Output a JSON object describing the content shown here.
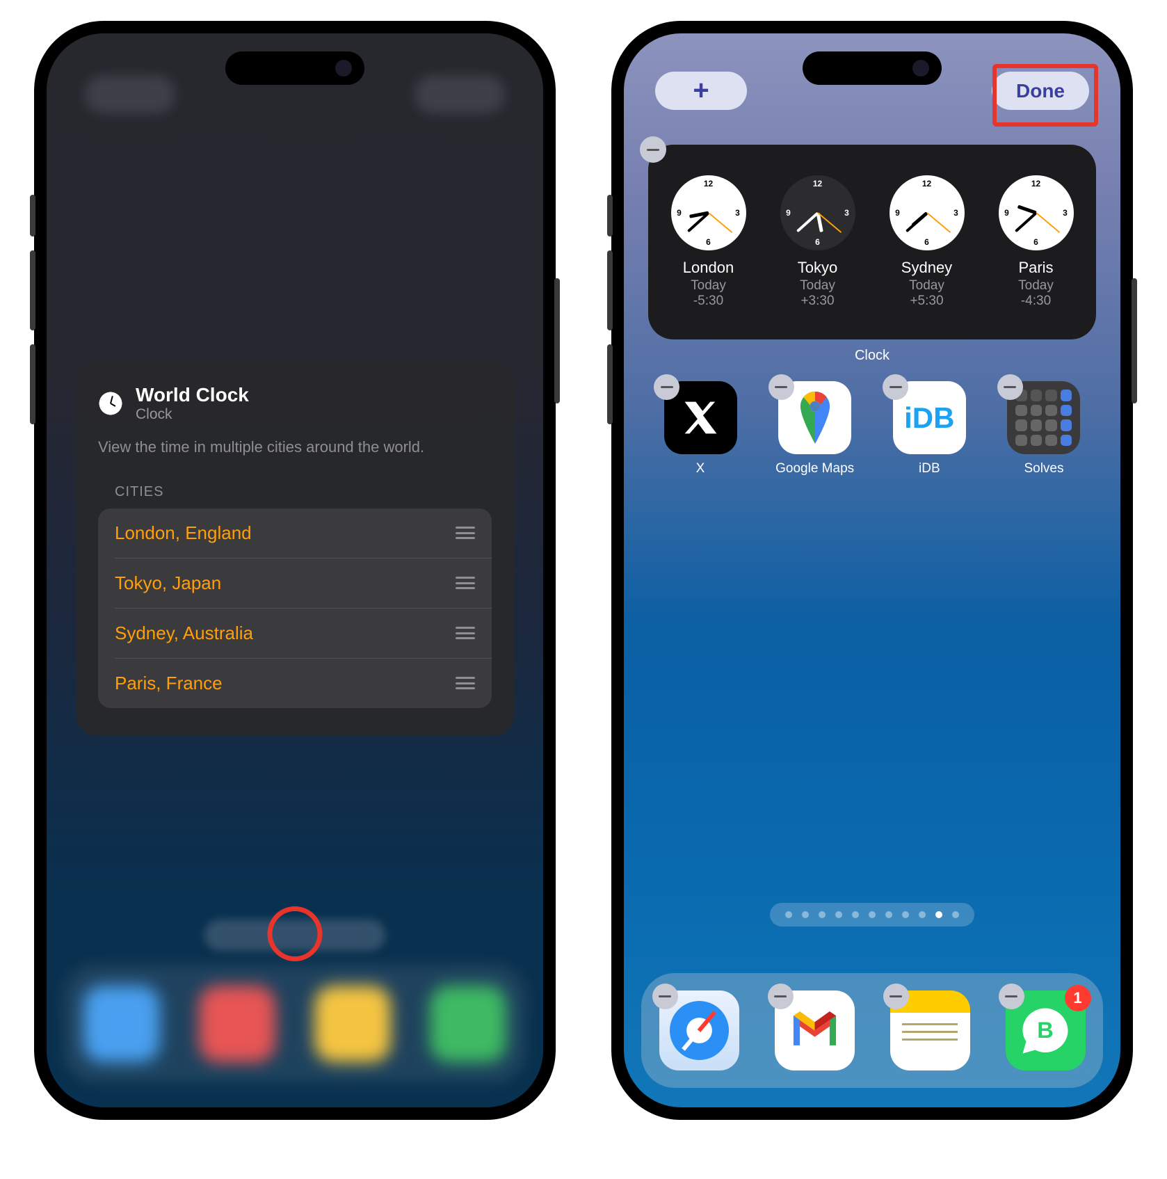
{
  "left": {
    "popup": {
      "title": "World Clock",
      "subtitle": "Clock",
      "description": "View the time in multiple cities around the world.",
      "section_label": "CITIES",
      "cities": [
        {
          "label": "London, England"
        },
        {
          "label": "Tokyo, Japan"
        },
        {
          "label": "Sydney, Australia"
        },
        {
          "label": "Paris, France"
        }
      ]
    }
  },
  "right": {
    "top": {
      "add_label": "+",
      "done_label": "Done"
    },
    "widget_label": "Clock",
    "clocks": [
      {
        "city": "London",
        "day": "Today",
        "offset": "-5:30",
        "theme": "light",
        "hour": 8,
        "minute": 38
      },
      {
        "city": "Tokyo",
        "day": "Today",
        "offset": "+3:30",
        "theme": "dark",
        "hour": 17,
        "minute": 38
      },
      {
        "city": "Sydney",
        "day": "Today",
        "offset": "+5:30",
        "theme": "light",
        "hour": 19,
        "minute": 38
      },
      {
        "city": "Paris",
        "day": "Today",
        "offset": "-4:30",
        "theme": "light",
        "hour": 9,
        "minute": 38
      }
    ],
    "apps": [
      {
        "label": "X",
        "icon": "x"
      },
      {
        "label": "Google Maps",
        "icon": "maps"
      },
      {
        "label": "iDB",
        "icon": "idb",
        "text": "iDB"
      },
      {
        "label": "Solves",
        "icon": "solves"
      }
    ],
    "pager": {
      "count": 11,
      "active": 9
    },
    "dock": [
      {
        "label": "Safari",
        "icon": "safari"
      },
      {
        "label": "Gmail",
        "icon": "gmail"
      },
      {
        "label": "Notes",
        "icon": "notes"
      },
      {
        "label": "WhatsApp Business",
        "icon": "whatsapp",
        "badge": "1"
      }
    ]
  }
}
